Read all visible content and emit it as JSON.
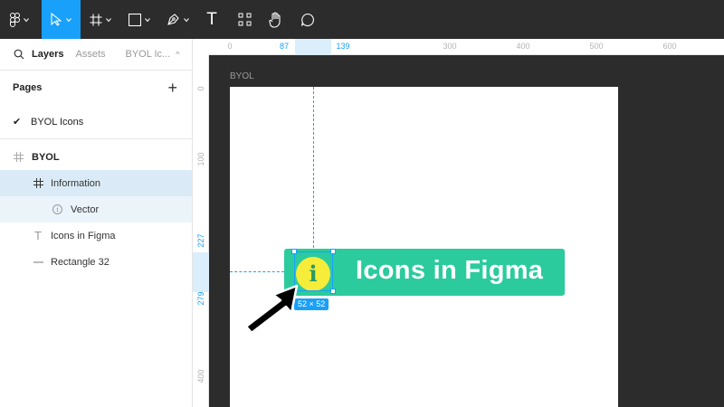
{
  "toolbar": {
    "tools": [
      {
        "name": "figma-menu-icon"
      },
      {
        "name": "move-tool-icon",
        "active": true
      },
      {
        "name": "frame-tool-icon"
      },
      {
        "name": "shape-tool-icon"
      },
      {
        "name": "pen-tool-icon"
      },
      {
        "name": "text-tool-icon",
        "glyph": "T"
      },
      {
        "name": "components-icon"
      },
      {
        "name": "hand-tool-icon"
      },
      {
        "name": "comment-tool-icon"
      }
    ],
    "active_color": "#18a0fb"
  },
  "sidebar": {
    "tabs": {
      "layers": "Layers",
      "assets": "Assets",
      "page": "BYOL Ic..."
    },
    "pages_heading": "Pages",
    "pages_add": "+",
    "pages": [
      {
        "label": "BYOL Icons",
        "current": true
      }
    ],
    "layers": [
      {
        "label": "BYOL",
        "icon": "frame-icon",
        "depth": 0
      },
      {
        "label": "Information",
        "icon": "frame-icon",
        "depth": 1,
        "selected": true
      },
      {
        "label": "Vector",
        "icon": "info-icon",
        "depth": 2
      },
      {
        "label": "Icons in Figma",
        "icon": "text-icon",
        "depth": 1
      },
      {
        "label": "Rectangle 32",
        "icon": "rectangle-icon",
        "depth": 1
      }
    ]
  },
  "rulers": {
    "top": [
      "0",
      "87",
      "139",
      "300",
      "400",
      "500",
      "600"
    ],
    "left": [
      "0",
      "100",
      "227",
      "279",
      "400"
    ]
  },
  "canvas": {
    "frame_name": "BYOL",
    "banner_text": "Icons in Figma",
    "icon_glyph": "i",
    "selection_size": "52 × 52",
    "colors": {
      "banner": "#2bcb9e",
      "icon_fill": "#f6ec3a",
      "selection": "#18a0fb",
      "canvas_bg": "#2c2c2c"
    }
  }
}
